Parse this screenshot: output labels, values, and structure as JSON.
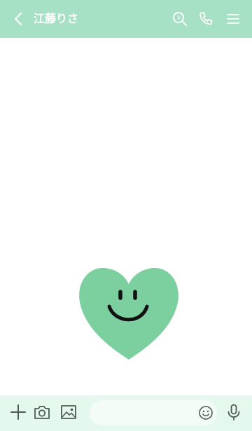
{
  "header": {
    "title": "江藤りさ",
    "icons": [
      "chevron-left-icon",
      "search-icon",
      "phone-icon",
      "menu-icon"
    ],
    "background_color": "#a6e0c5",
    "text_color": "#ffffff"
  },
  "chat": {
    "background_color": "#ffffff",
    "sticker": {
      "name": "smiling-heart",
      "heart_color": "#7ccf9f",
      "face_color": "#111111"
    }
  },
  "footer": {
    "background_color": "#e5f8ee",
    "input_value": "",
    "input_placeholder": "",
    "icons": [
      "plus-icon",
      "camera-icon",
      "image-icon",
      "emoji-icon",
      "mic-icon"
    ],
    "icon_color": "#4f5a55"
  }
}
